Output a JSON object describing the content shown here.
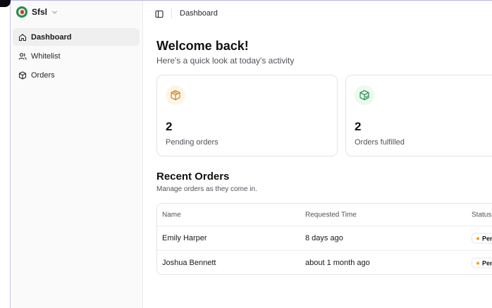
{
  "app": {
    "name": "Sfsl",
    "breadcrumb": "Dashboard"
  },
  "sidebar": {
    "items": [
      {
        "label": "Dashboard",
        "icon": "home-icon",
        "active": true
      },
      {
        "label": "Whitelist",
        "icon": "users-icon",
        "active": false
      },
      {
        "label": "Orders",
        "icon": "package-icon",
        "active": false
      }
    ]
  },
  "main": {
    "title": "Welcome back!",
    "subtitle": "Here's a quick look at today's activity",
    "cards": [
      {
        "value": "2",
        "label": "Pending orders",
        "icon": "package-icon",
        "color": "#c98a2f"
      },
      {
        "value": "2",
        "label": "Orders fulfilled",
        "icon": "package-check-icon",
        "color": "#2f9a55"
      }
    ],
    "recent": {
      "title": "Recent Orders",
      "subtitle": "Manage orders as they come in.",
      "columns": [
        "Name",
        "Requested Time",
        "Status"
      ],
      "rows": [
        {
          "name": "Emily Harper",
          "time": "8 days ago",
          "status": "Pending"
        },
        {
          "name": "Joshua Bennett",
          "time": "about 1 month ago",
          "status": "Pending"
        }
      ]
    }
  },
  "colors": {
    "accent_pending": "#f59e0b",
    "sidebar_bg": "#fafafa",
    "border": "#e4e4e7"
  }
}
